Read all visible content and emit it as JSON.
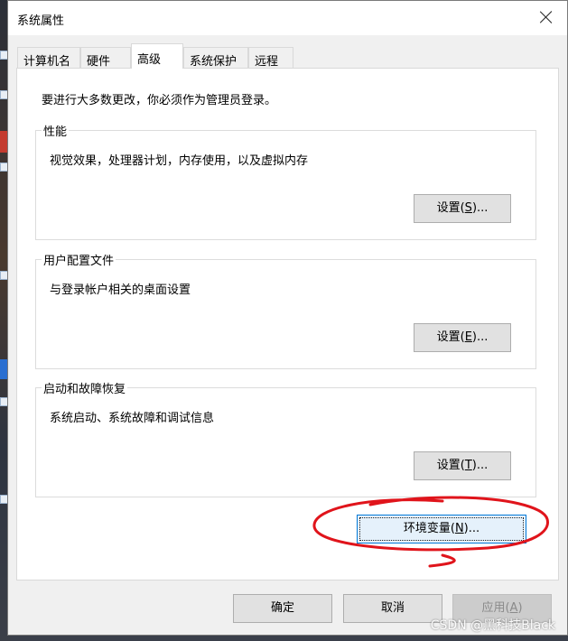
{
  "window": {
    "title": "系统属性"
  },
  "tabs": [
    {
      "label": "计算机名"
    },
    {
      "label": "硬件"
    },
    {
      "label": "高级"
    },
    {
      "label": "系统保护"
    },
    {
      "label": "远程"
    }
  ],
  "admin_notice": "要进行大多数更改，你必须作为管理员登录。",
  "performance": {
    "legend": "性能",
    "desc": "视觉效果，处理器计划，内存使用，以及虚拟内存",
    "btn_pre": "设置(",
    "btn_key": "S",
    "btn_post": ")..."
  },
  "user_profiles": {
    "legend": "用户配置文件",
    "desc": "与登录帐户相关的桌面设置",
    "btn_pre": "设置(",
    "btn_key": "E",
    "btn_post": ")..."
  },
  "startup_recovery": {
    "legend": "启动和故障恢复",
    "desc": "系统启动、系统故障和调试信息",
    "btn_pre": "设置(",
    "btn_key": "T",
    "btn_post": ")..."
  },
  "env_vars": {
    "pre": "环境变量(",
    "key": "N",
    "post": ")..."
  },
  "footer": {
    "ok": "确定",
    "cancel": "取消",
    "apply_pre": "应用(",
    "apply_key": "A",
    "apply_post": ")"
  },
  "watermark": "CSDN @黑科技Black",
  "colors": {
    "annotation": "#e0141b",
    "focus_border": "#0078d7"
  }
}
